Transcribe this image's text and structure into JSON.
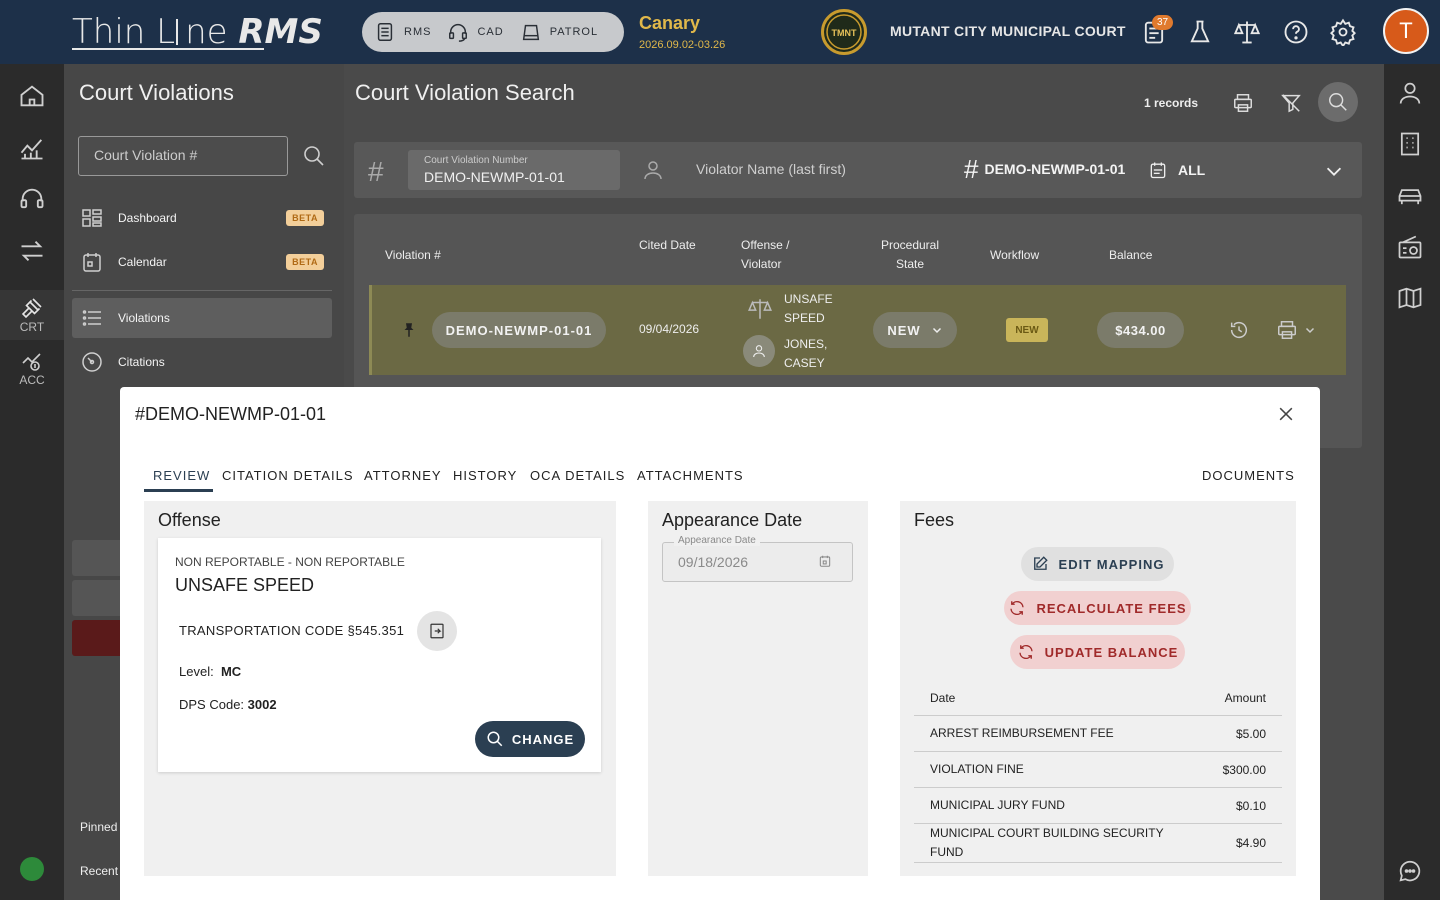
{
  "app": {
    "brand_thin": "Thin L",
    "brand_ine": "ne ",
    "brand_rms": "RMS",
    "modules": [
      "RMS",
      "CAD",
      "PATROL"
    ],
    "env_name": "Canary",
    "env_version": "2026.09.02-03.26",
    "court_name": "MUTANT CITY MUNICIPAL COURT",
    "notification_count": "37",
    "user_initial": "T"
  },
  "left_rail": {
    "items": [
      {
        "name": "home",
        "label": ""
      },
      {
        "name": "analytics",
        "label": ""
      },
      {
        "name": "dispatch",
        "label": ""
      },
      {
        "name": "transfer",
        "label": ""
      },
      {
        "name": "court",
        "label": "CRT"
      },
      {
        "name": "accounting",
        "label": "ACC"
      }
    ]
  },
  "sidenav": {
    "title": "Court Violations",
    "search_placeholder": "Court Violation #",
    "items": [
      {
        "label": "Dashboard",
        "badge": "BETA"
      },
      {
        "label": "Calendar",
        "badge": "BETA"
      },
      {
        "label": "Violations",
        "badge": ""
      },
      {
        "label": "Citations",
        "badge": ""
      }
    ],
    "pinned_label": "Pinned",
    "recent_label": "Recent"
  },
  "main": {
    "title": "Court Violation Search",
    "records": "1 records",
    "filter": {
      "number_label": "Court Violation Number",
      "number_value": "DEMO-NEWMP-01-01",
      "violator_placeholder": "Violator Name (last first)",
      "chip_number": "DEMO-NEWMP-01-01",
      "chip_date": "ALL"
    },
    "table": {
      "headers": [
        "Violation #",
        "Cited Date",
        "Offense / Violator",
        "Procedural State",
        "Workflow",
        "Balance"
      ],
      "row": {
        "violation": "DEMO-NEWMP-01-01",
        "cited_date": "09/04/2026",
        "offense_line1": "UNSAFE",
        "offense_line2": "SPEED",
        "violator_line1": "JONES,",
        "violator_line2": "CASEY",
        "state": "NEW",
        "workflow": "NEW",
        "balance": "$434.00"
      }
    }
  },
  "modal": {
    "title": "#DEMO-NEWMP-01-01",
    "tabs": [
      "REVIEW",
      "CITATION DETAILS",
      "ATTORNEY",
      "HISTORY",
      "OCA DETAILS",
      "ATTACHMENTS"
    ],
    "documents_label": "DOCUMENTS",
    "offense": {
      "panel_title": "Offense",
      "type": "NON REPORTABLE - NON REPORTABLE",
      "name": "UNSAFE SPEED",
      "statute": "TRANSPORTATION CODE §545.351",
      "level_label": "Level:",
      "level_value": "MC",
      "dps_label": "DPS Code:",
      "dps_value": "3002",
      "change_label": "CHANGE"
    },
    "appearance": {
      "panel_title": "Appearance Date",
      "field_label": "Appearance Date",
      "field_value": "09/18/2026"
    },
    "fees": {
      "panel_title": "Fees",
      "edit_label": "EDIT MAPPING",
      "recalc_label": "RECALCULATE FEES",
      "update_label": "UPDATE BALANCE",
      "col_date": "Date",
      "col_amount": "Amount",
      "rows": [
        {
          "desc": "ARREST REIMBURSEMENT FEE",
          "amount": "$5.00"
        },
        {
          "desc": "VIOLATION FINE",
          "amount": "$300.00"
        },
        {
          "desc": "MUNICIPAL JURY FUND",
          "amount": "$0.10"
        },
        {
          "desc": "MUNICIPAL COURT BUILDING SECURITY FUND",
          "amount": "$4.90"
        }
      ]
    }
  },
  "colors": {
    "topbar": "#1d3049",
    "accent": "#2b3f52",
    "env": "#e1b84a",
    "danger": "#a02a2a"
  }
}
